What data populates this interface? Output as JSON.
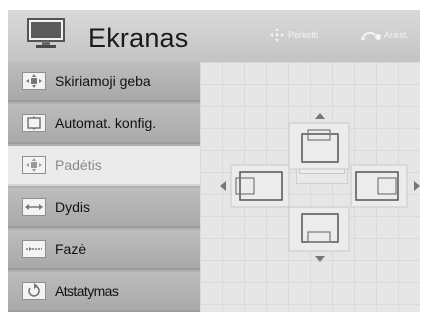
{
  "header": {
    "title": "Ekranas",
    "hints": [
      {
        "icon": "move-arrows-icon",
        "label": "Perkelti"
      },
      {
        "icon": "back-icon",
        "label": "Ankst."
      }
    ]
  },
  "sidebar": {
    "items": [
      {
        "label": "Skiriamoji geba",
        "icon": "resolution-icon",
        "active": false
      },
      {
        "label": "Automat. konfig.",
        "icon": "auto-config-icon",
        "active": false
      },
      {
        "label": "Padėtis",
        "icon": "position-icon",
        "active": true
      },
      {
        "label": "Dydis",
        "icon": "size-icon",
        "active": false
      },
      {
        "label": "Fazė",
        "icon": "phase-icon",
        "active": false
      },
      {
        "label": "Atstatymas",
        "icon": "reset-icon",
        "active": false
      }
    ]
  },
  "position_pad": {
    "directions": [
      "up",
      "down",
      "left",
      "right"
    ]
  },
  "colors": {
    "header_bg": "#cfcfcf",
    "sidebar_item_bg": "#b3b3b3",
    "active_item_bg": "#ebebeb",
    "main_bg": "#e6e6e6"
  }
}
